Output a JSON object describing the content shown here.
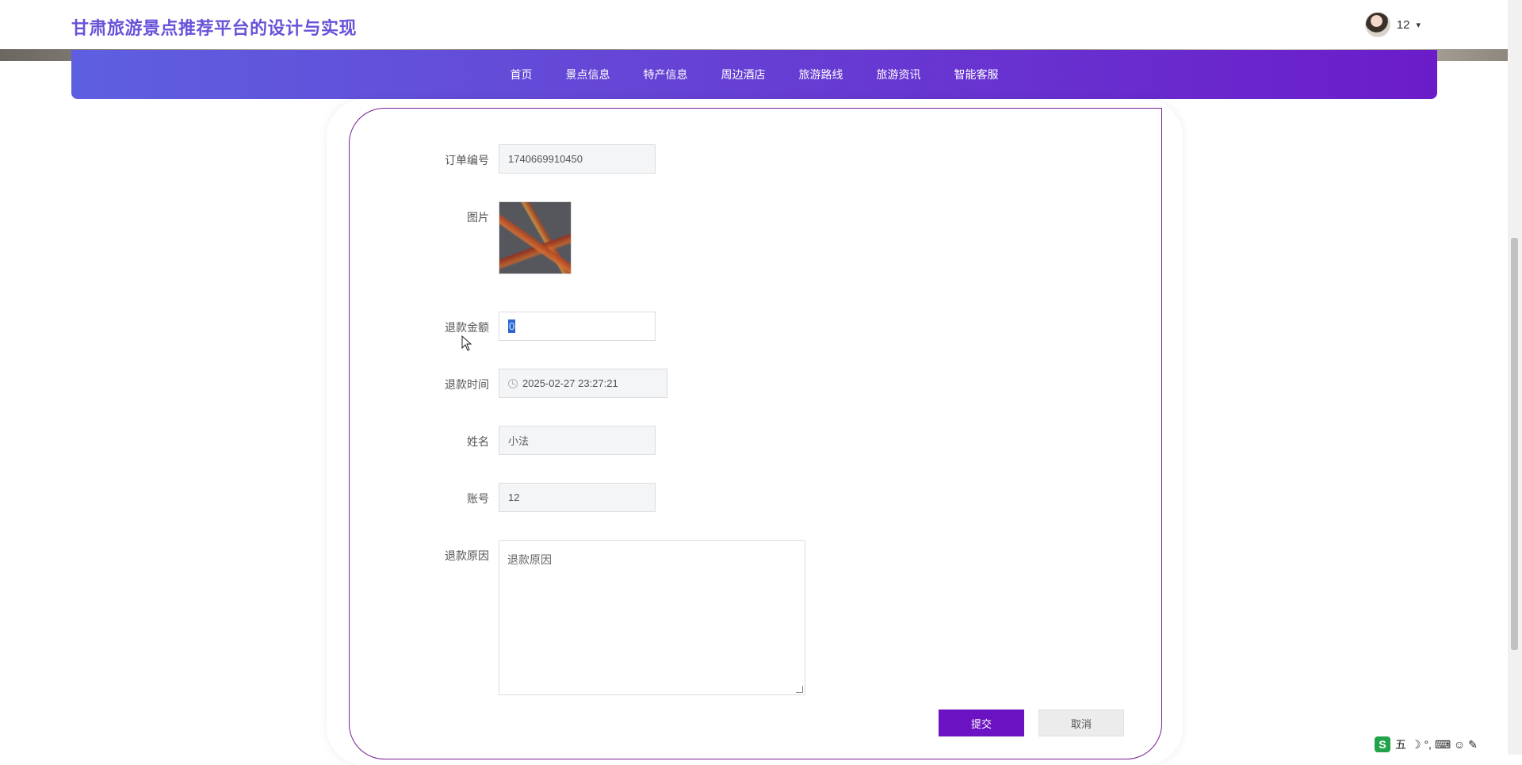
{
  "header": {
    "site_title": "甘肃旅游景点推荐平台的设计与实现",
    "username": "12",
    "caret": "▾"
  },
  "nav": {
    "items": [
      "首页",
      "景点信息",
      "特产信息",
      "周边酒店",
      "旅游路线",
      "旅游资讯",
      "智能客服"
    ]
  },
  "form": {
    "order_no": {
      "label": "订单编号",
      "value": "1740669910450"
    },
    "image": {
      "label": "图片"
    },
    "refund_amount": {
      "label": "退款金额",
      "value": "0"
    },
    "refund_time": {
      "label": "退款时间",
      "value": "2025-02-27 23:27:21"
    },
    "name": {
      "label": "姓名",
      "value": "小法"
    },
    "account": {
      "label": "账号",
      "value": "12"
    },
    "refund_reason": {
      "label": "退款原因",
      "placeholder": "退款原因"
    },
    "submit_label": "提交",
    "cancel_label": "取消"
  },
  "ime": {
    "logo": "S",
    "mode": "五",
    "symbols": "☽ °, ⌨ ☺ ✎"
  },
  "colors": {
    "brand_title": "#6a52d9",
    "nav_start": "#5e5fe0",
    "nav_end": "#6b1cc9",
    "submit_bg": "#6b12c3",
    "card_border": "#7b1f95"
  }
}
